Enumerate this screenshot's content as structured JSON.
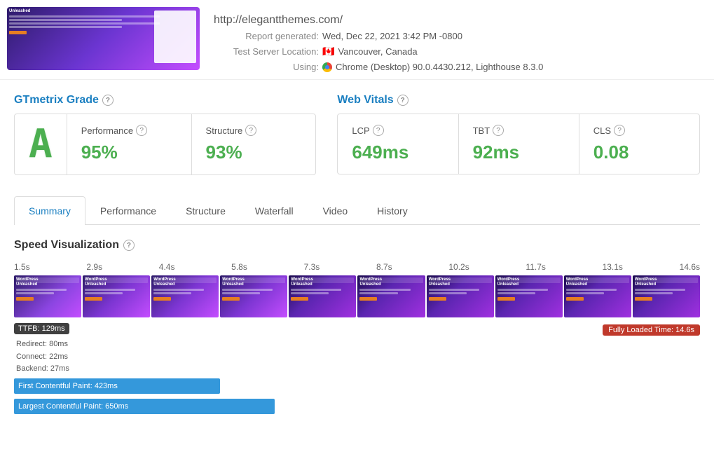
{
  "header": {
    "site_url": "http://elegantthemes.com/",
    "report_label": "Report generated:",
    "report_date": "Wed, Dec 22, 2021 3:42 PM -0800",
    "server_label": "Test Server Location:",
    "server_location": "Vancouver, Canada",
    "using_label": "Using:",
    "using_value": "Chrome (Desktop) 90.0.4430.212, Lighthouse 8.3.0"
  },
  "thumbnail": {
    "title": "Unleashed",
    "subtitle": "The Most Popular WordPress Themes In The World And The Ultimate Visual Page Builder"
  },
  "gtmetrix": {
    "title": "GTmetrix Grade",
    "grade": "A",
    "performance_label": "Performance",
    "performance_value": "95%",
    "structure_label": "Structure",
    "structure_value": "93%"
  },
  "web_vitals": {
    "title": "Web Vitals",
    "lcp_label": "LCP",
    "lcp_value": "649ms",
    "tbt_label": "TBT",
    "tbt_value": "92ms",
    "cls_label": "CLS",
    "cls_value": "0.08"
  },
  "tabs": {
    "items": [
      {
        "id": "summary",
        "label": "Summary",
        "active": true
      },
      {
        "id": "performance",
        "label": "Performance",
        "active": false
      },
      {
        "id": "structure",
        "label": "Structure",
        "active": false
      },
      {
        "id": "waterfall",
        "label": "Waterfall",
        "active": false
      },
      {
        "id": "video",
        "label": "Video",
        "active": false
      },
      {
        "id": "history",
        "label": "History",
        "active": false
      }
    ]
  },
  "speed_viz": {
    "title": "Speed Visualization",
    "time_labels": [
      "1.5s",
      "2.9s",
      "4.4s",
      "5.8s",
      "7.3s",
      "8.7s",
      "10.2s",
      "11.7s",
      "13.1s",
      "14.6s"
    ],
    "ttfb": "TTFB: 129ms",
    "fully_loaded": "Fully Loaded Time: 14.6s",
    "redirect": "Redirect: 80ms",
    "connect": "Connect: 22ms",
    "backend": "Backend: 27ms",
    "fcp_label": "First Contentful Paint: 423ms",
    "lcp_label": "Largest Contentful Paint: 650ms"
  }
}
